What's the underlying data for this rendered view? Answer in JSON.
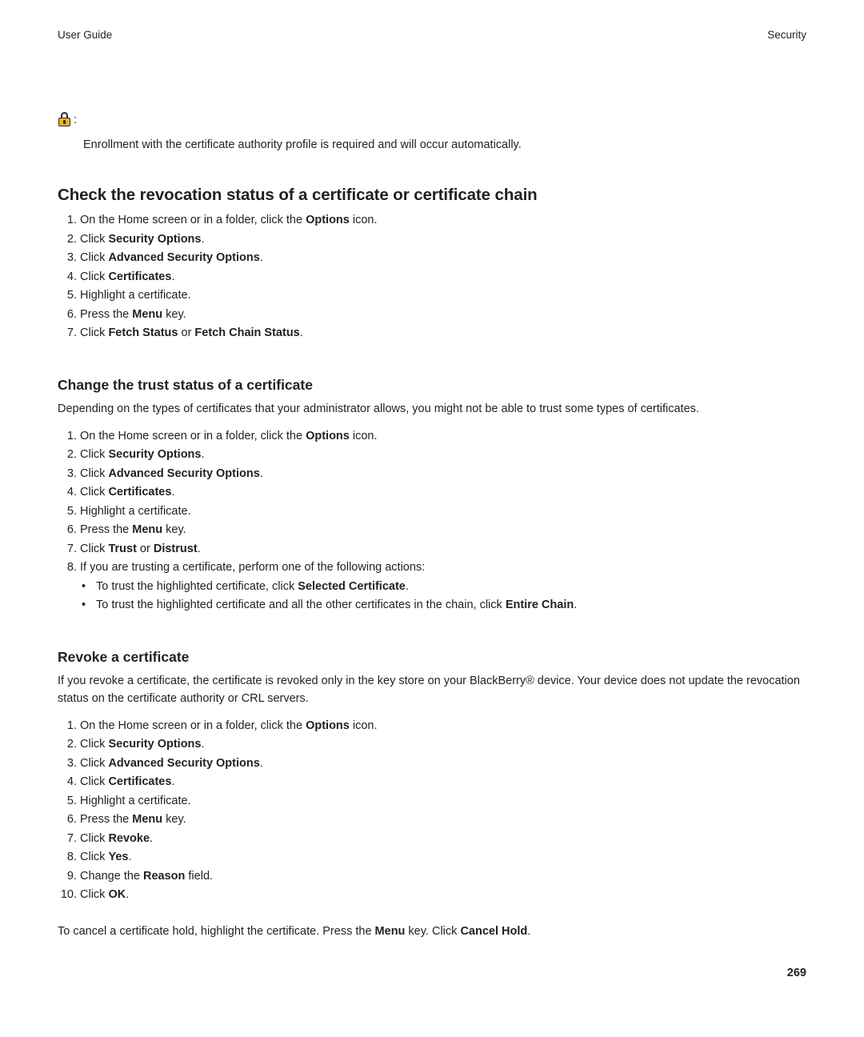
{
  "header": {
    "left": "User Guide",
    "right": "Security"
  },
  "note": {
    "icon": "lock-icon",
    "colon": ":",
    "text": "Enrollment with the certificate authority profile is required and will occur automatically."
  },
  "sections": [
    {
      "title": "Check the revocation status of a certificate or certificate chain",
      "steps": [
        {
          "num": "1.",
          "parts": [
            {
              "t": "On the Home screen or in a folder, click the ",
              "b": false
            },
            {
              "t": "Options",
              "b": true
            },
            {
              "t": " icon.",
              "b": false
            }
          ]
        },
        {
          "num": "2.",
          "parts": [
            {
              "t": "Click ",
              "b": false
            },
            {
              "t": "Security Options",
              "b": true
            },
            {
              "t": ".",
              "b": false
            }
          ]
        },
        {
          "num": "3.",
          "parts": [
            {
              "t": "Click ",
              "b": false
            },
            {
              "t": "Advanced Security Options",
              "b": true
            },
            {
              "t": ".",
              "b": false
            }
          ]
        },
        {
          "num": "4.",
          "parts": [
            {
              "t": "Click ",
              "b": false
            },
            {
              "t": "Certificates",
              "b": true
            },
            {
              "t": ".",
              "b": false
            }
          ]
        },
        {
          "num": "5.",
          "parts": [
            {
              "t": "Highlight a certificate.",
              "b": false
            }
          ]
        },
        {
          "num": "6.",
          "parts": [
            {
              "t": "Press the ",
              "b": false
            },
            {
              "t": "Menu",
              "b": true
            },
            {
              "t": " key.",
              "b": false
            }
          ]
        },
        {
          "num": "7.",
          "parts": [
            {
              "t": "Click ",
              "b": false
            },
            {
              "t": "Fetch Status",
              "b": true
            },
            {
              "t": " or ",
              "b": false
            },
            {
              "t": "Fetch Chain Status",
              "b": true
            },
            {
              "t": ".",
              "b": false
            }
          ]
        }
      ]
    },
    {
      "title": "Change the trust status of a certificate",
      "intro": "Depending on the types of certificates that your administrator allows, you might not be able to trust some types of certificates.",
      "steps": [
        {
          "num": "1.",
          "parts": [
            {
              "t": "On the Home screen or in a folder, click the ",
              "b": false
            },
            {
              "t": "Options",
              "b": true
            },
            {
              "t": " icon.",
              "b": false
            }
          ]
        },
        {
          "num": "2.",
          "parts": [
            {
              "t": "Click ",
              "b": false
            },
            {
              "t": "Security Options",
              "b": true
            },
            {
              "t": ".",
              "b": false
            }
          ]
        },
        {
          "num": "3.",
          "parts": [
            {
              "t": "Click ",
              "b": false
            },
            {
              "t": "Advanced Security Options",
              "b": true
            },
            {
              "t": ".",
              "b": false
            }
          ]
        },
        {
          "num": "4.",
          "parts": [
            {
              "t": "Click ",
              "b": false
            },
            {
              "t": "Certificates",
              "b": true
            },
            {
              "t": ".",
              "b": false
            }
          ]
        },
        {
          "num": "5.",
          "parts": [
            {
              "t": "Highlight a certificate.",
              "b": false
            }
          ]
        },
        {
          "num": "6.",
          "parts": [
            {
              "t": "Press the ",
              "b": false
            },
            {
              "t": "Menu",
              "b": true
            },
            {
              "t": " key.",
              "b": false
            }
          ]
        },
        {
          "num": "7.",
          "parts": [
            {
              "t": "Click ",
              "b": false
            },
            {
              "t": "Trust",
              "b": true
            },
            {
              "t": " or ",
              "b": false
            },
            {
              "t": "Distrust",
              "b": true
            },
            {
              "t": ".",
              "b": false
            }
          ]
        },
        {
          "num": "8.",
          "parts": [
            {
              "t": "If you are trusting a certificate, perform one of the following actions:",
              "b": false
            }
          ]
        }
      ],
      "bullets": [
        {
          "dot": "•",
          "parts": [
            {
              "t": "To trust the highlighted certificate, click ",
              "b": false
            },
            {
              "t": "Selected Certificate",
              "b": true
            },
            {
              "t": ".",
              "b": false
            }
          ]
        },
        {
          "dot": "•",
          "parts": [
            {
              "t": "To trust the highlighted certificate and all the other certificates in the chain, click ",
              "b": false
            },
            {
              "t": "Entire Chain",
              "b": true
            },
            {
              "t": ".",
              "b": false
            }
          ]
        }
      ]
    },
    {
      "title": "Revoke a certificate",
      "intro": "If you revoke a certificate, the certificate is revoked only in the key store on your BlackBerry® device. Your device does not update the revocation status on the certificate authority or CRL servers.",
      "steps": [
        {
          "num": "1.",
          "parts": [
            {
              "t": "On the Home screen or in a folder, click the ",
              "b": false
            },
            {
              "t": "Options",
              "b": true
            },
            {
              "t": " icon.",
              "b": false
            }
          ]
        },
        {
          "num": "2.",
          "parts": [
            {
              "t": "Click ",
              "b": false
            },
            {
              "t": "Security Options",
              "b": true
            },
            {
              "t": ".",
              "b": false
            }
          ]
        },
        {
          "num": "3.",
          "parts": [
            {
              "t": "Click ",
              "b": false
            },
            {
              "t": "Advanced Security Options",
              "b": true
            },
            {
              "t": ".",
              "b": false
            }
          ]
        },
        {
          "num": "4.",
          "parts": [
            {
              "t": "Click ",
              "b": false
            },
            {
              "t": "Certificates",
              "b": true
            },
            {
              "t": ".",
              "b": false
            }
          ]
        },
        {
          "num": "5.",
          "parts": [
            {
              "t": "Highlight a certificate.",
              "b": false
            }
          ]
        },
        {
          "num": "6.",
          "parts": [
            {
              "t": "Press the ",
              "b": false
            },
            {
              "t": "Menu",
              "b": true
            },
            {
              "t": " key.",
              "b": false
            }
          ]
        },
        {
          "num": "7.",
          "parts": [
            {
              "t": "Click ",
              "b": false
            },
            {
              "t": "Revoke",
              "b": true
            },
            {
              "t": ".",
              "b": false
            }
          ]
        },
        {
          "num": "8.",
          "parts": [
            {
              "t": "Click ",
              "b": false
            },
            {
              "t": "Yes",
              "b": true
            },
            {
              "t": ".",
              "b": false
            }
          ]
        },
        {
          "num": "9.",
          "parts": [
            {
              "t": "Change the ",
              "b": false
            },
            {
              "t": "Reason",
              "b": true
            },
            {
              "t": " field.",
              "b": false
            }
          ]
        },
        {
          "num": "10.",
          "parts": [
            {
              "t": "Click ",
              "b": false
            },
            {
              "t": "OK",
              "b": true
            },
            {
              "t": ".",
              "b": false
            }
          ]
        }
      ],
      "outro": [
        {
          "t": "To cancel a certificate hold, highlight the certificate. Press the ",
          "b": false
        },
        {
          "t": "Menu",
          "b": true
        },
        {
          "t": " key. Click ",
          "b": false
        },
        {
          "t": "Cancel Hold",
          "b": true
        },
        {
          "t": ".",
          "b": false
        }
      ]
    }
  ],
  "page_number": "269"
}
